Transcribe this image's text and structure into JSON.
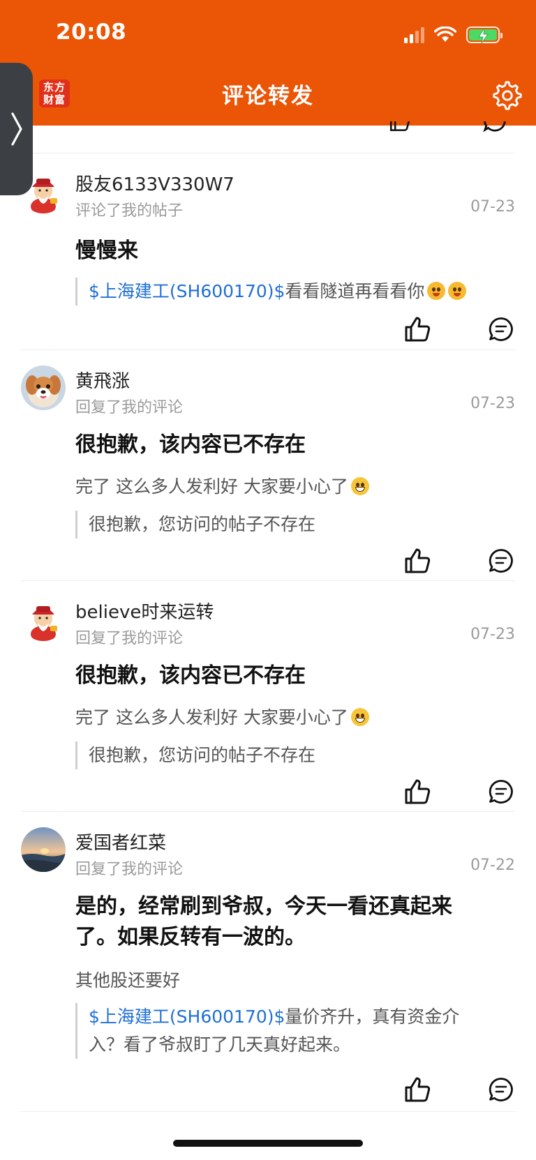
{
  "status_bar": {
    "time": "20:08"
  },
  "nav": {
    "title": "评论转发",
    "logo_text_line1": "东方",
    "logo_text_line2": "财富",
    "settings_icon": "gear-icon",
    "side_tab_icon": "chevron-right-icon"
  },
  "feed": [
    {
      "user": "股友6133V330W7",
      "action": "评论了我的帖子",
      "date": "07-23",
      "content": "慢慢来",
      "extra": "",
      "quote_link": "$上海建工(SH600170)$",
      "quote_text": "看看隧道再看看你",
      "quote_emojis": 2,
      "avatar": "god-of-wealth"
    },
    {
      "user": "黄飛涨",
      "action": "回复了我的评论",
      "date": "07-23",
      "content": "很抱歉，该内容已不存在",
      "extra": "完了 这么多人发利好 大家要小心了",
      "quote_link": "",
      "quote_text": "很抱歉，您访问的帖子不存在",
      "avatar": "dog"
    },
    {
      "user": "believe时来运转",
      "action": "回复了我的评论",
      "date": "07-23",
      "content": "很抱歉，该内容已不存在",
      "extra": "完了 这么多人发利好 大家要小心了",
      "quote_link": "",
      "quote_text": "很抱歉，您访问的帖子不存在",
      "avatar": "god-of-wealth"
    },
    {
      "user": "爱国者红菜",
      "action": "回复了我的评论",
      "date": "07-22",
      "content_line1": "是的，经常刷到爷叔，今天一看还真起来",
      "content_line2": "了。如果反转有一波的。",
      "extra": "其他股还要好",
      "quote_link": "$上海建工(SH600170)$",
      "quote_text_line1": "量价齐升，真有资金介",
      "quote_text_line2": "入？看了爷叔盯了几天真好起来。",
      "avatar": "sunset-landscape"
    }
  ]
}
